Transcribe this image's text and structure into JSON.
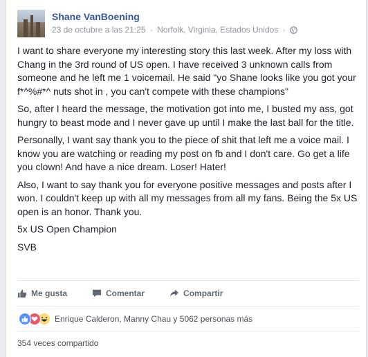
{
  "post": {
    "author": "Shane VanBoening",
    "date": "23 de octubre a las 21:25",
    "separator": "·",
    "location": "Norfolk, Virginia, Estados Unidos",
    "privacy_icon": "globe-icon",
    "paragraphs": [
      "I want to share everyone my interesting story this last week. After my loss with Chang in the 3rd round of US open. I have received 3 unknown calls from someone and he left me 1 voicemail. He said \"yo Shane looks like you got your f*^%#*^ nuts shot in , you can't compete with these champions\"",
      "So, after I heard the message, the motivation got into me, I busted my ass, got hungry to beast mode and I never gave up until I make the last ball for the title.",
      "Personally, I want say thank you to the piece of shit that left me a voice mail. I know you are watching or reading my post on fb and I don't care. Go get a life you clown! And have a nice dream. Loser! Hater!",
      "Also, I want to say thank you for everyone positive messages and posts after I won. I couldn't keep up with all my messages from all my fans. Being the 5x US open is an honor. Thank you.",
      "5x US Open Champion",
      "SVB"
    ]
  },
  "actions": {
    "like": "Me gusta",
    "comment": "Comentar",
    "share": "Compartir"
  },
  "reactions": {
    "icons": [
      "like-reaction-icon",
      "love-reaction-icon",
      "haha-reaction-icon"
    ],
    "summary": "Enrique Calderon, Manny Chau y 5062 personas más"
  },
  "shares": "354 veces compartido",
  "colors": {
    "link": "#365899",
    "meta": "#90949c",
    "text": "#1d2129",
    "like": "#5890ff",
    "love": "#f25268",
    "haha": "#ffd972"
  }
}
